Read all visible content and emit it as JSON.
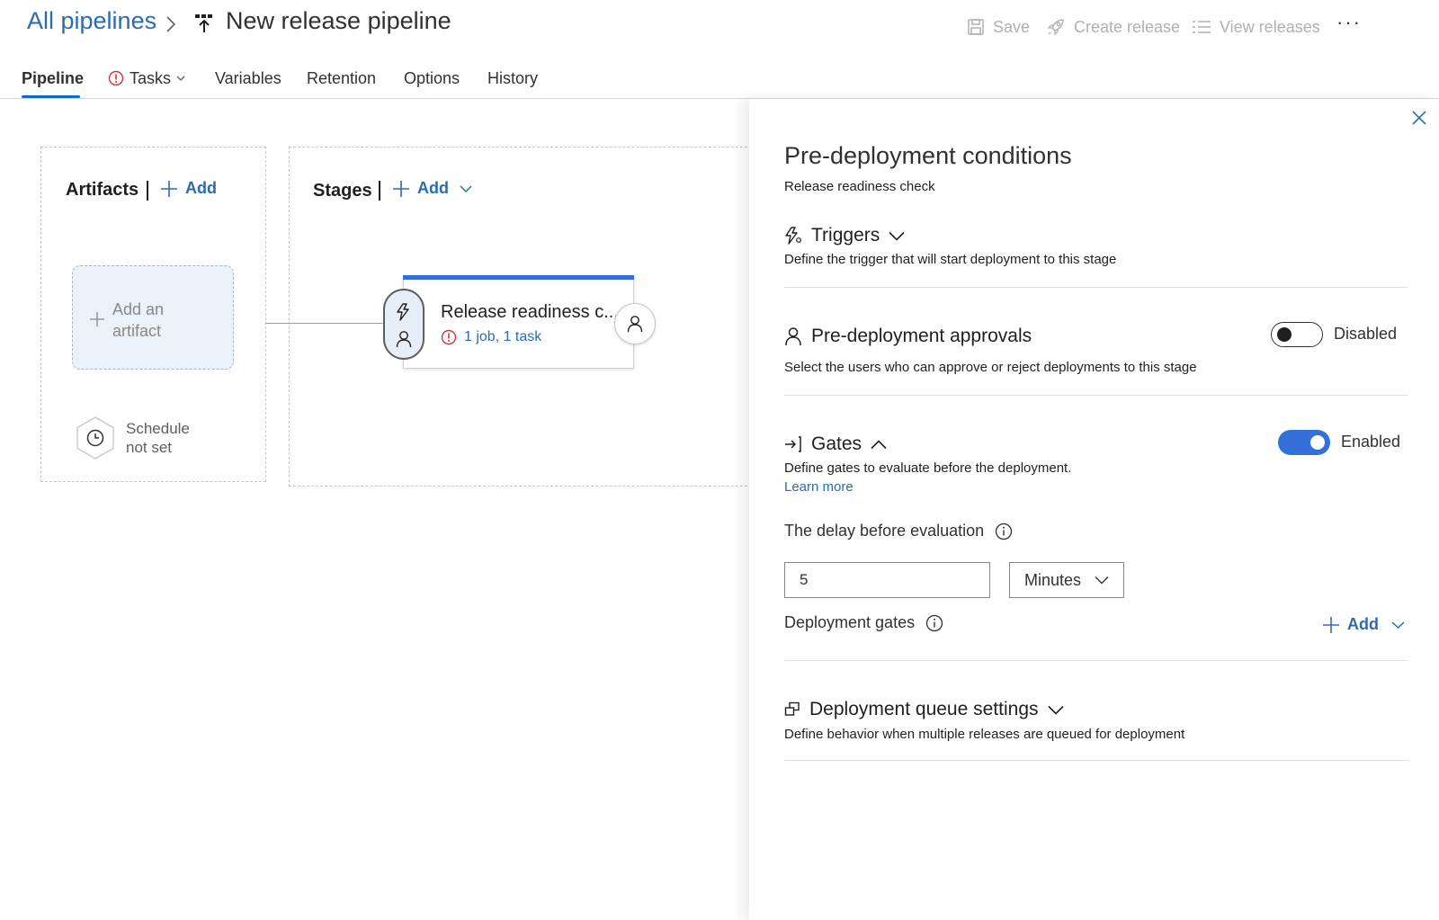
{
  "header": {
    "breadcrumb_link": "All pipelines",
    "pipeline_title": "New release pipeline",
    "toolbar": {
      "save": "Save",
      "create_release": "Create release",
      "view_releases": "View releases",
      "more": "···"
    }
  },
  "tabs": [
    {
      "label": "Pipeline",
      "active": true
    },
    {
      "label": "Tasks",
      "active": false,
      "warning": true
    },
    {
      "label": "Variables",
      "active": false
    },
    {
      "label": "Retention",
      "active": false
    },
    {
      "label": "Options",
      "active": false
    },
    {
      "label": "History",
      "active": false
    }
  ],
  "canvas": {
    "artifacts": {
      "title": "Artifacts",
      "add_label": "Add",
      "placeholder_line1": "Add an",
      "placeholder_line2": "artifact",
      "schedule_line1": "Schedule",
      "schedule_line2": "not set"
    },
    "stages": {
      "title": "Stages",
      "add_label": "Add",
      "stage": {
        "name": "Release readiness c...",
        "summary": "1 job, 1 task"
      }
    }
  },
  "panel": {
    "title": "Pre-deployment conditions",
    "subtitle": "Release readiness check",
    "triggers": {
      "title": "Triggers",
      "description": "Define the trigger that will start deployment to this stage"
    },
    "approvals": {
      "title": "Pre-deployment approvals",
      "toggle_state": "Disabled",
      "enabled": false,
      "description": "Select the users who can approve or reject deployments to this stage"
    },
    "gates": {
      "title": "Gates",
      "toggle_state": "Enabled",
      "enabled": true,
      "description": "Define gates to evaluate before the deployment.",
      "learn_more": "Learn more",
      "delay_label": "The delay before evaluation",
      "delay_value": "5",
      "delay_unit": "Minutes",
      "deployment_gates_label": "Deployment gates",
      "add_label": "Add"
    },
    "queue": {
      "title": "Deployment queue settings",
      "description": "Define behavior when multiple releases are queued for deployment"
    }
  },
  "colors": {
    "accent": "#2b6cb0",
    "toggle_on": "#3470d8",
    "stage_bar": "#2f6fd3",
    "warning": "#d13438"
  }
}
